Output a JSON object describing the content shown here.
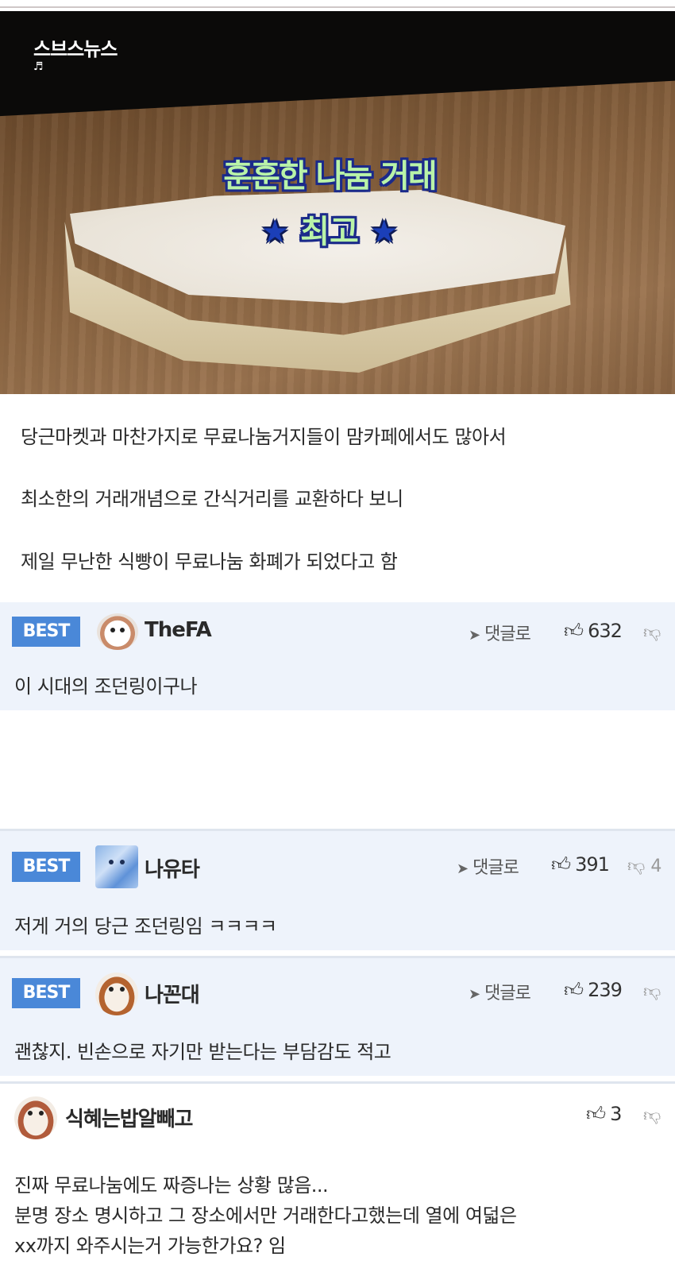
{
  "hero": {
    "logo": "스브스뉴스",
    "logo_note": "♬",
    "caption_line1": "훈훈한 나눔 거래",
    "caption_star": "★",
    "caption_line2": "최고"
  },
  "article": {
    "paragraphs": [
      "당근마켓과 마찬가지로 무료나눔거지들이 맘카페에서도 많아서",
      "최소한의 거래개념으로 간식거리를 교환하다 보니",
      "제일 무난한 식빵이 무료나눔 화폐가 되었다고 함"
    ]
  },
  "comments": [
    {
      "best_label": "BEST",
      "nick": "TheFA",
      "reply_label": "댓글로",
      "likes": "632",
      "dislikes": "",
      "text": "이 시대의 조던링이구나"
    },
    {
      "best_label": "BEST",
      "nick": "나유타",
      "reply_label": "댓글로",
      "likes": "391",
      "dislikes": "4",
      "text": "저게 거의 당근 조던링임 ㅋㅋㅋㅋ"
    },
    {
      "best_label": "BEST",
      "nick": "나꼰대",
      "reply_label": "댓글로",
      "likes": "239",
      "dislikes": "",
      "text": "괜찮지. 빈손으로 자기만 받는다는 부담감도 적고"
    },
    {
      "nick": "식혜는밥알빼고",
      "likes": "3",
      "dislikes": "",
      "text_lines": [
        "진짜 무료나눔에도 짜증나는 상황 많음...",
        "분명 장소 명시하고 그 장소에서만 거래한다고했는데 열에 여덟은",
        "xx까지 와주시는거 가능한가요? 임"
      ]
    }
  ]
}
